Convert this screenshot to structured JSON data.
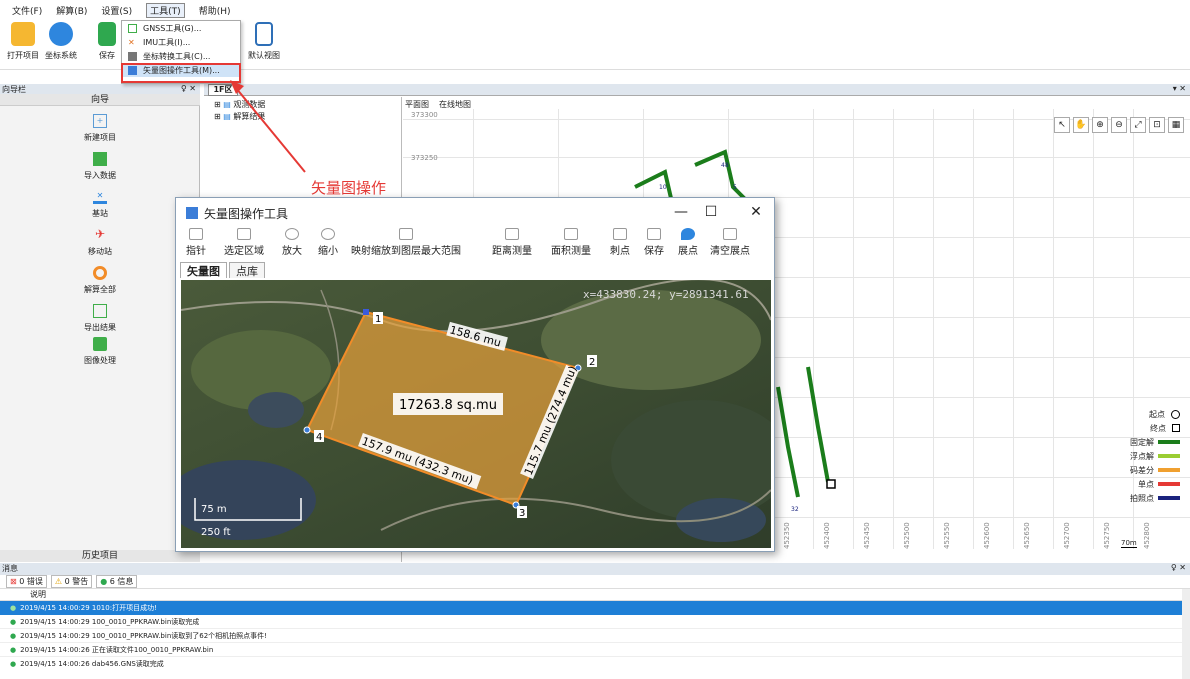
{
  "menu": [
    "文件(F)",
    "解算(B)",
    "设置(S)",
    "工具(T)",
    "帮助(H)"
  ],
  "toolbar": {
    "open": "打开项目",
    "coord": "坐标系统",
    "save": "保存",
    "default_view": "默认视图"
  },
  "dropdown": [
    "GNSS工具(G)...",
    "IMU工具(I)...",
    "坐标转换工具(C)...",
    "矢量图操作工具(M)..."
  ],
  "annotation": "矢量图操作",
  "nav": {
    "title": "向导栏",
    "pin": "♀ ✕",
    "header": "向导",
    "items": [
      "新建项目",
      "导入数据",
      "基站",
      "移动站",
      "解算全部",
      "导出结果",
      "图像处理"
    ],
    "footer": "历史项目"
  },
  "doc_tab": "1F区",
  "doc_close": "▾ ✕",
  "tree": [
    "观测数据",
    "解算结果"
  ],
  "map": {
    "tabs": [
      "平面图",
      "在线地图"
    ],
    "ylabels": [
      "373300",
      "373250",
      "373200"
    ],
    "xlabels": [
      "452350",
      "452400",
      "452450",
      "452500",
      "452550",
      "452600",
      "452650",
      "452700",
      "452750",
      "452800"
    ],
    "tools": [
      "↖",
      "✋",
      "⊕",
      "⊖",
      "⤢",
      "⊡",
      "▦"
    ],
    "scale": "70m",
    "legend": [
      {
        "label": "起点",
        "kind": "circle"
      },
      {
        "label": "终点",
        "kind": "square"
      },
      {
        "label": "固定解",
        "color": "#1b7d1b"
      },
      {
        "label": "浮点解",
        "color": "#9acd32"
      },
      {
        "label": "码差分",
        "color": "#f0a030"
      },
      {
        "label": "单点",
        "color": "#e53935"
      },
      {
        "label": "拍照点",
        "color": "#1a237e"
      }
    ],
    "route_labels": [
      "10",
      "48",
      "5",
      "32"
    ]
  },
  "dialog": {
    "title": "矢量图操作工具",
    "controls": [
      "—",
      "☐",
      "✕"
    ],
    "tools": [
      "指针",
      "选定区域",
      "放大",
      "缩小",
      "映射缩放到图层最大范围",
      "距离测量",
      "面积测量",
      "刺点",
      "保存",
      "展点",
      "清空展点"
    ],
    "tabs": [
      "矢量图",
      "点库"
    ],
    "coords": "x=433830.24; y=2891341.61",
    "polygon": {
      "area": "17263.8 sq.mu",
      "edges": [
        "158.6 mu",
        "115.7 mu (274.4 mu)",
        "157.9 mu (432.3 mu)"
      ],
      "vertices": [
        "1",
        "2",
        "3",
        "4"
      ]
    },
    "scale": [
      "75 m",
      "250 ft"
    ]
  },
  "messages": {
    "title": "消息",
    "pin": "♀ ✕",
    "filters": [
      "0 错误",
      "0 警告",
      "6 信息"
    ],
    "column": "说明",
    "rows": [
      "2019/4/15 14:00:29  1010:打开项目成功!",
      "2019/4/15 14:00:29  100_0010_PPKRAW.bin读取完成",
      "2019/4/15 14:00:29  100_0010_PPKRAW.bin读取到了62个相机拍照点事件!",
      "2019/4/15 14:00:26  正在读取文件100_0010_PPKRAW.bin",
      "2019/4/15 14:00:26  dab456.GNS读取完成"
    ]
  }
}
